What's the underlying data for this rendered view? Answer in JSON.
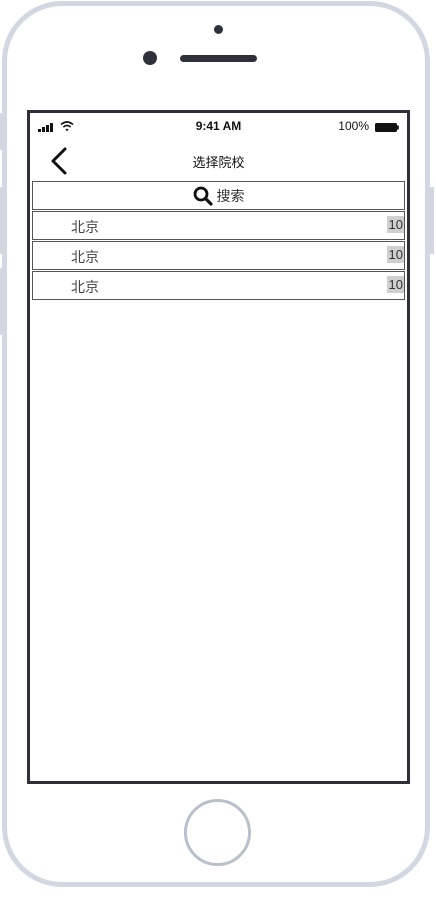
{
  "status_bar": {
    "time": "9:41 AM",
    "battery_percent": "100%",
    "signal_icon": "cellular-signal-icon",
    "wifi_icon": "wifi-icon",
    "battery_icon": "battery-icon"
  },
  "nav": {
    "back_icon": "chevron-left-icon",
    "title": "选择院校"
  },
  "search": {
    "icon": "search-icon",
    "label": "搜索"
  },
  "schools": [
    {
      "name": "北京",
      "count": "10"
    },
    {
      "name": "北京",
      "count": "10"
    },
    {
      "name": "北京",
      "count": "10"
    }
  ],
  "colors": {
    "frame": "#d2d7e1",
    "screen_border": "#2f303a",
    "count_badge": "#cfcfcf"
  }
}
